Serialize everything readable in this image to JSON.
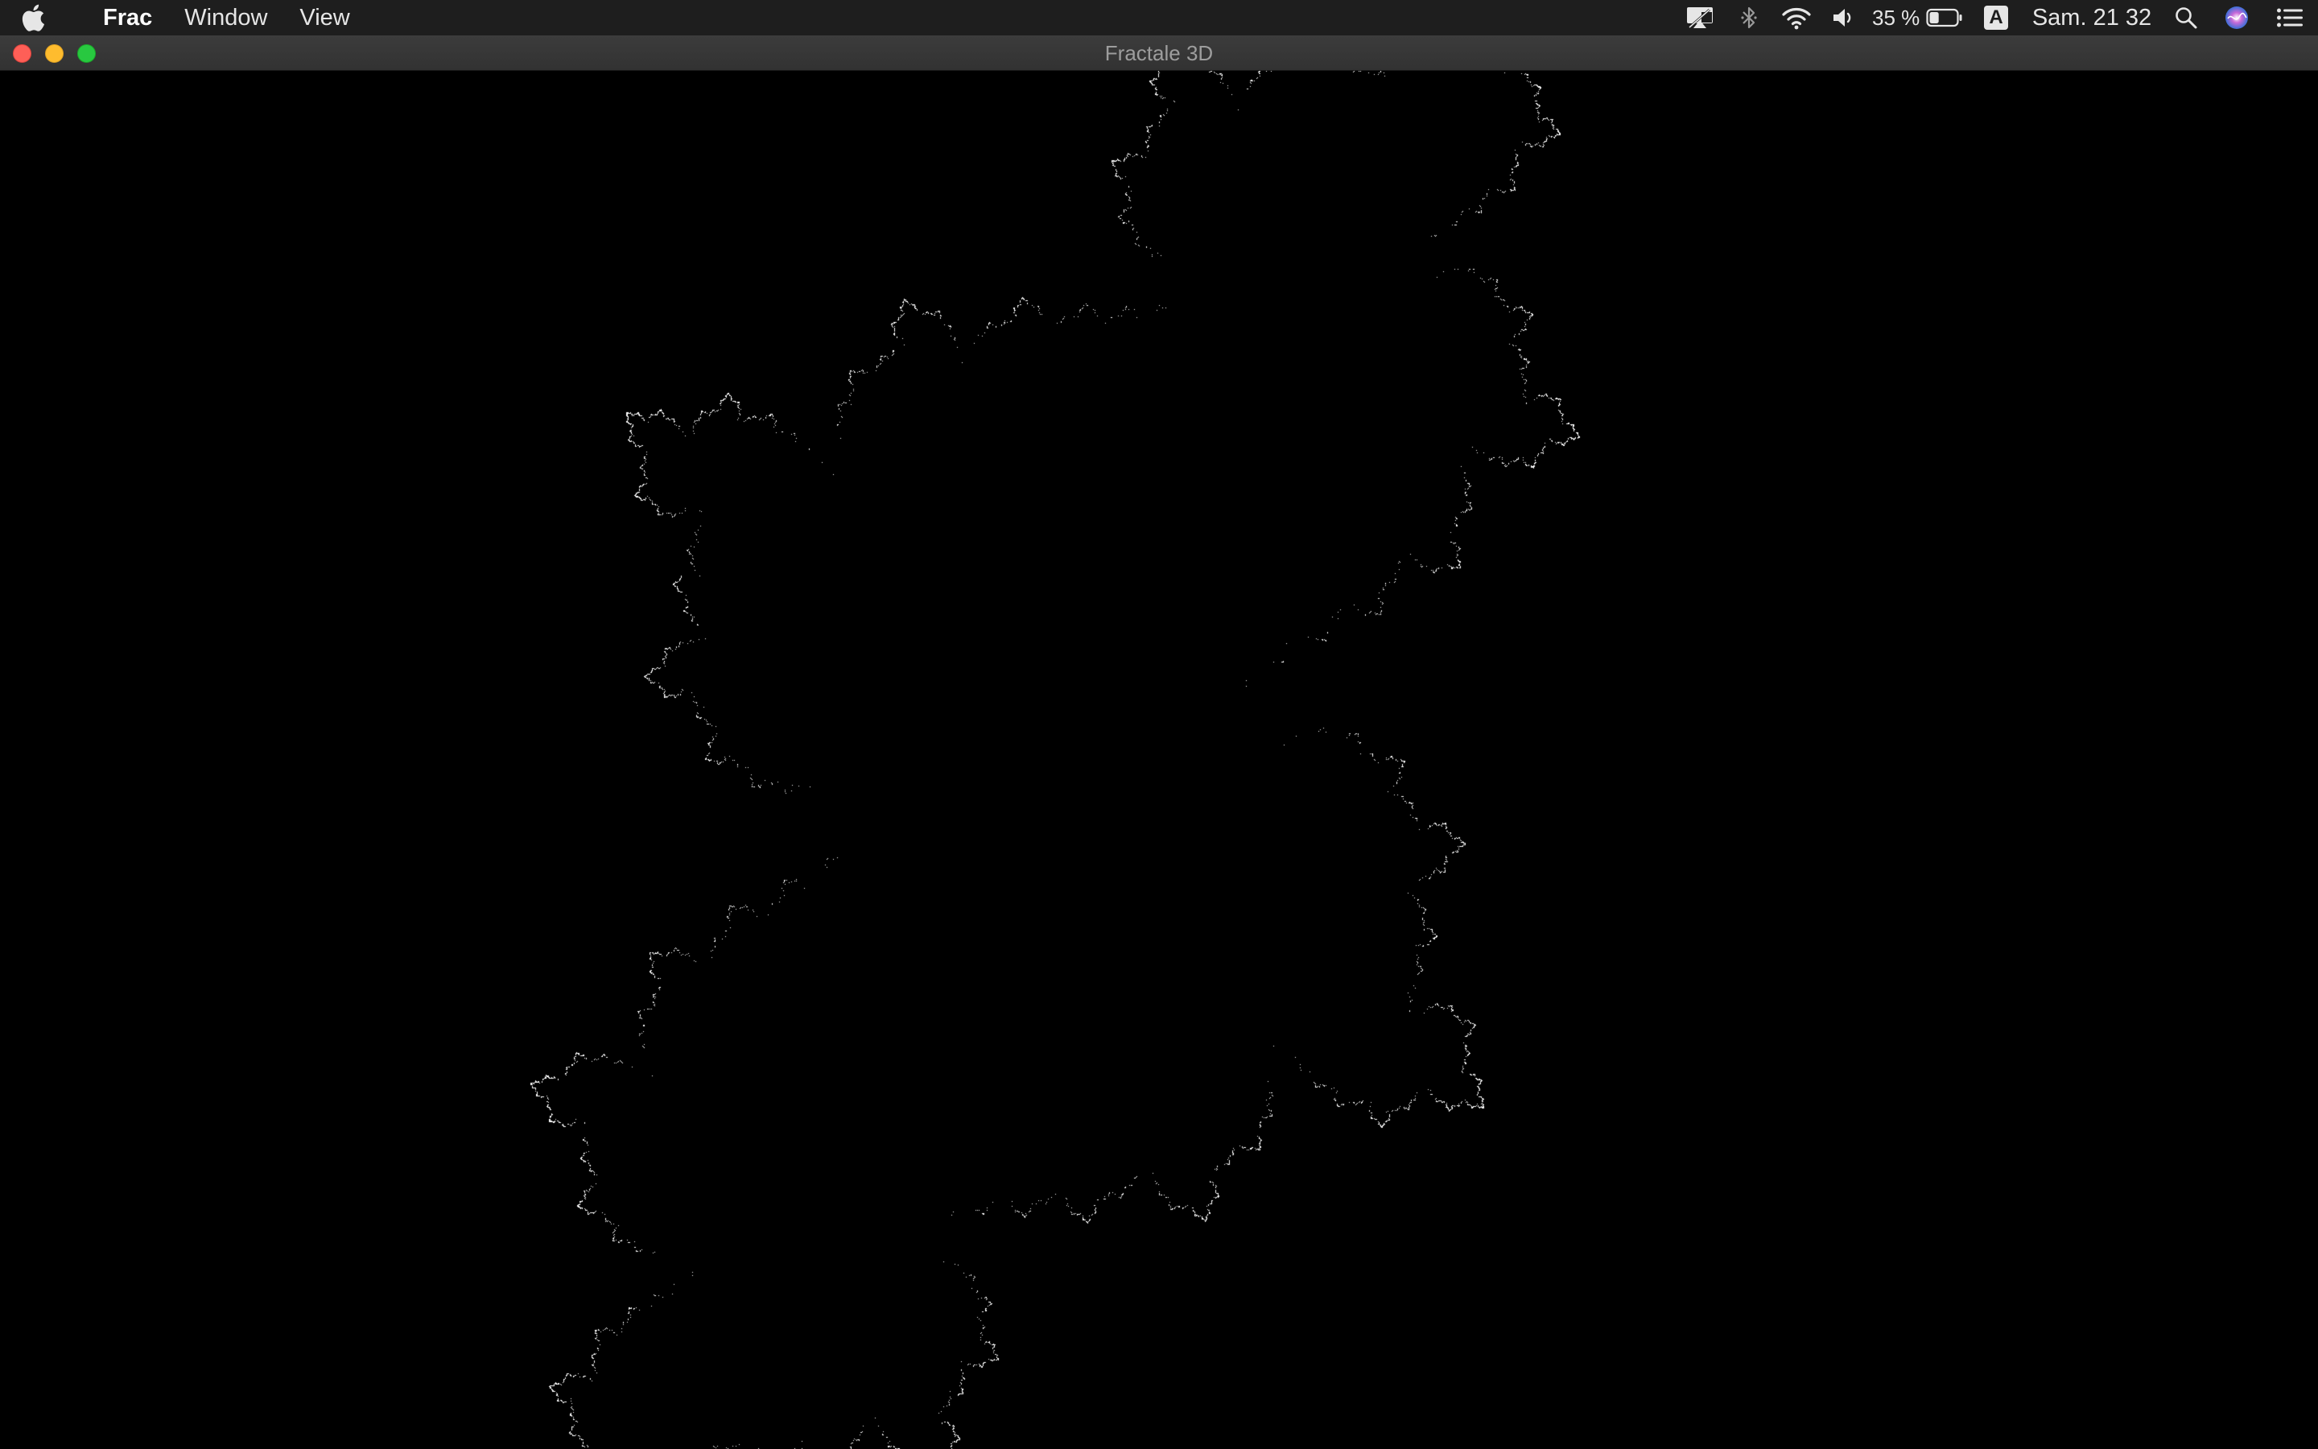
{
  "menubar": {
    "apple_icon": "apple-logo-icon",
    "app_name": "Frac",
    "menus": [
      "Window",
      "View"
    ],
    "status": {
      "battery_percent": "35 %",
      "battery_level": 0.35,
      "input_source": "A",
      "clock": "Sam. 21 32"
    },
    "status_icons": [
      "airplay-icon",
      "bluetooth-icon",
      "wifi-icon",
      "volume-icon",
      "battery-icon",
      "input-source-icon",
      "spotlight-search-icon",
      "siri-icon",
      "notification-center-icon"
    ]
  },
  "window": {
    "title": "Fractale 3D",
    "buttons": [
      "close",
      "minimize",
      "zoom"
    ],
    "background_color": "#000000",
    "fractal_color": "#ffffff"
  }
}
